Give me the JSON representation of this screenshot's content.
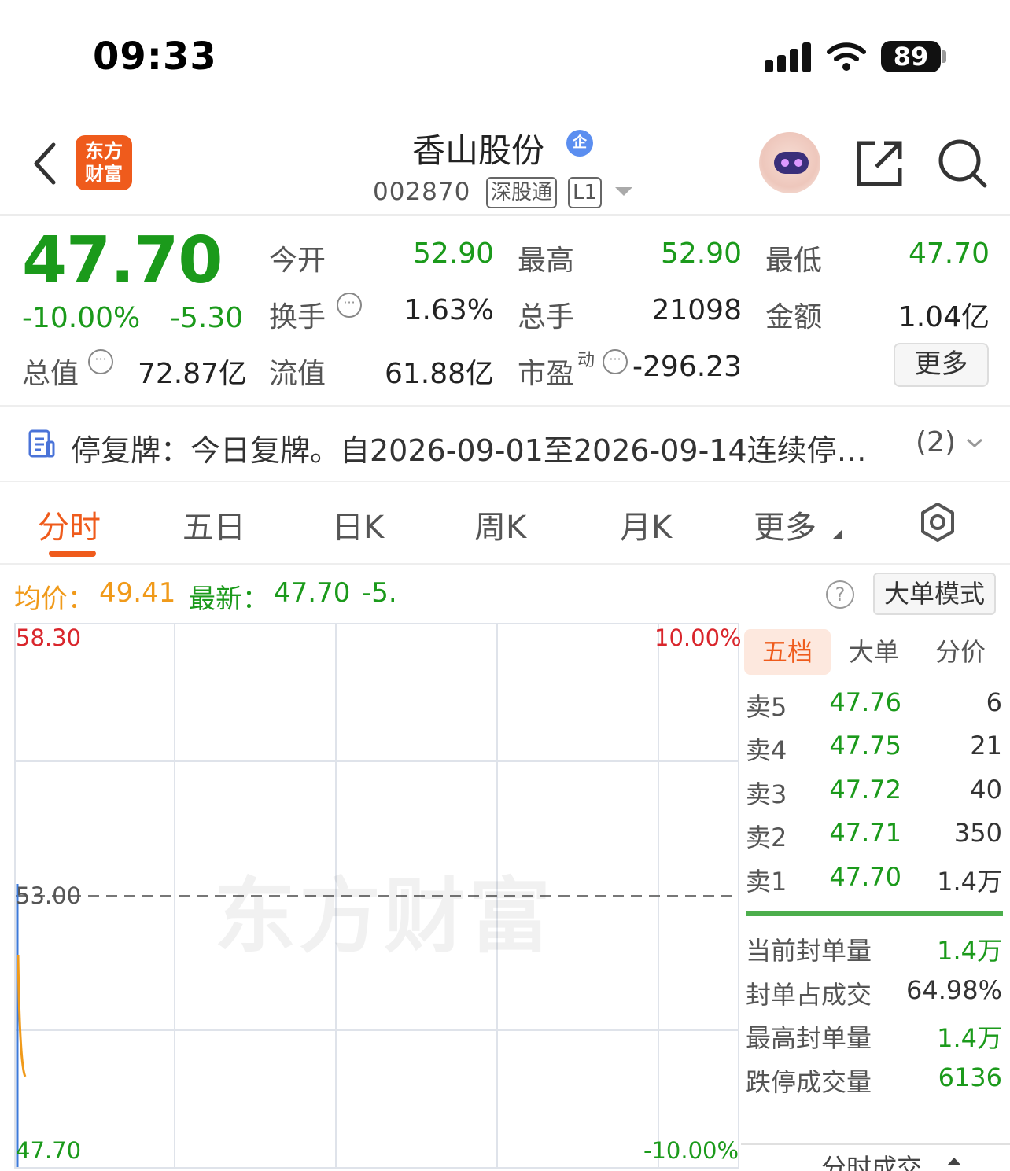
{
  "status_bar": {
    "time": "09:33",
    "battery": "89"
  },
  "header": {
    "logo_line1": "东方",
    "logo_line2": "财富",
    "title": "香山股份",
    "badge": "企",
    "code": "002870",
    "tag_connect": "深股通",
    "tag_level": "L1"
  },
  "quote": {
    "price": "47.70",
    "change_pct": "-10.00%",
    "change": "-5.30",
    "open_label": "今开",
    "open": "52.90",
    "high_label": "最高",
    "high": "52.90",
    "low_label": "最低",
    "low": "47.70",
    "turnover_label": "换手",
    "turnover": "1.63%",
    "volume_label": "总手",
    "volume": "21098",
    "amount_label": "金额",
    "amount": "1.04亿",
    "mktcap_label": "总值",
    "mktcap": "72.87亿",
    "float_label": "流值",
    "float_cap": "61.88亿",
    "pe_label": "市盈",
    "pe_sup": "动",
    "pe": "-296.23",
    "more": "更多"
  },
  "notice": {
    "text": "停复牌：今日复牌。自2026-09-01至2026-09-14连续停…",
    "count": "(2)"
  },
  "tabs": [
    "分时",
    "五日",
    "日K",
    "周K",
    "月K",
    "更多"
  ],
  "info_bar": {
    "avg_label": "均价：",
    "avg": "49.41",
    "latest_label": "最新：",
    "latest": "47.70",
    "change": "-5.",
    "mode_button": "大单模式"
  },
  "chart_data": {
    "type": "line",
    "y_max": "58.30",
    "y_mid": "53.00",
    "y_min": "47.70",
    "pct_max": "10.00%",
    "pct_min": "-10.00%",
    "ylim": [
      47.7,
      58.3
    ],
    "series": [],
    "watermark": "东方财富",
    "colors": {
      "price": "#3c7ad9",
      "avg": "#f09a1a"
    }
  },
  "order_book": {
    "tabs": [
      "五档",
      "大单",
      "分价"
    ],
    "asks": [
      {
        "label": "卖5",
        "price": "47.76",
        "vol": "6"
      },
      {
        "label": "卖4",
        "price": "47.75",
        "vol": "21"
      },
      {
        "label": "卖3",
        "price": "47.72",
        "vol": "40"
      },
      {
        "label": "卖2",
        "price": "47.71",
        "vol": "350"
      },
      {
        "label": "卖1",
        "price": "47.70",
        "vol": "1.4万"
      }
    ],
    "seal": [
      {
        "label": "当前封单量",
        "value": "1.4万"
      },
      {
        "label": "封单占成交",
        "value": "64.98%"
      },
      {
        "label": "最高封单量",
        "value": "1.4万"
      },
      {
        "label": "跌停成交量",
        "value": "6136"
      }
    ],
    "footer": "分时成交"
  }
}
